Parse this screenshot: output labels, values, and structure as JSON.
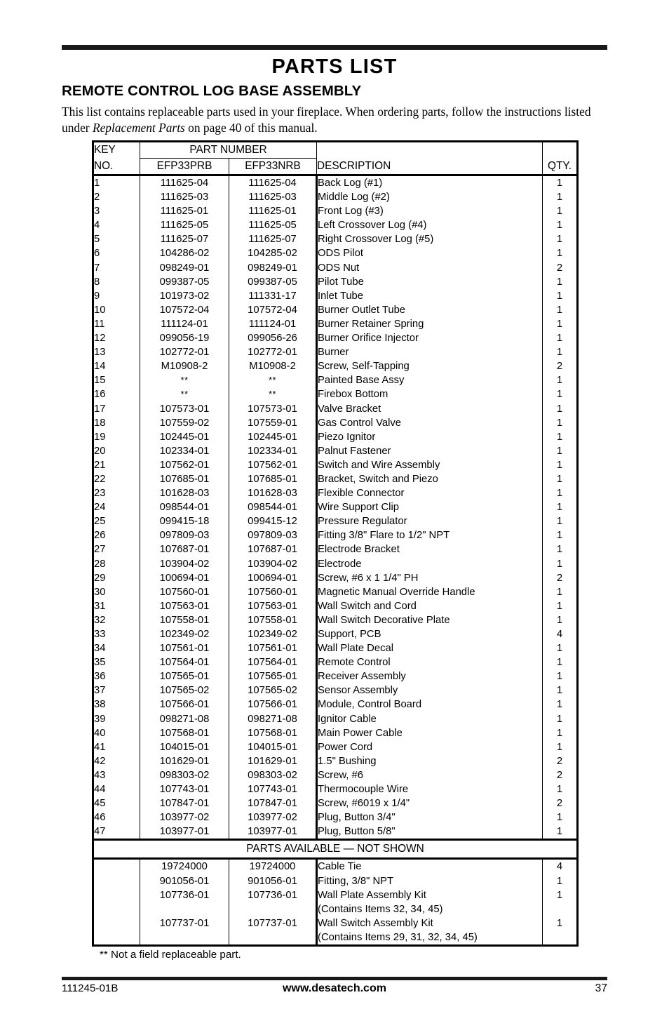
{
  "document": {
    "page_title": "PARTS LIST",
    "section_title": "REMOTE CONTROL LOG BASE ASSEMBLY",
    "intro_part1": "This list contains replaceable parts used in your fireplace. When ordering parts, follow the instructions listed under ",
    "intro_italic": "Replacement Parts",
    "intro_part2": " on page 40 of this manual.",
    "footnote": "** Not a field replaceable part.",
    "rule_color": "#1a1a1a"
  },
  "table": {
    "headers": {
      "key_line1": "KEY",
      "key_line2": "NO.",
      "part_number_group": "PART NUMBER",
      "model_1": "EFP33PRB",
      "model_2": "EFP33NRB",
      "description": "DESCRIPTION",
      "qty": "QTY."
    },
    "banner": "PARTS AVAILABLE — NOT SHOWN",
    "rows": [
      {
        "key": "1",
        "p1": "111625-04",
        "p2": "111625-04",
        "desc": "Back Log (#1)",
        "qty": "1"
      },
      {
        "key": "2",
        "p1": "111625-03",
        "p2": "111625-03",
        "desc": "Middle Log (#2)",
        "qty": "1"
      },
      {
        "key": "3",
        "p1": "111625-01",
        "p2": "111625-01",
        "desc": "Front Log (#3)",
        "qty": "1"
      },
      {
        "key": "4",
        "p1": "111625-05",
        "p2": "111625-05",
        "desc": "Left Crossover Log (#4)",
        "qty": "1"
      },
      {
        "key": "5",
        "p1": "111625-07",
        "p2": "111625-07",
        "desc": "Right Crossover Log (#5)",
        "qty": "1"
      },
      {
        "key": "6",
        "p1": "104286-02",
        "p2": "104285-02",
        "desc": "ODS Pilot",
        "qty": "1"
      },
      {
        "key": "7",
        "p1": "098249-01",
        "p2": "098249-01",
        "desc": "ODS Nut",
        "qty": "2"
      },
      {
        "key": "8",
        "p1": "099387-05",
        "p2": "099387-05",
        "desc": "Pilot Tube",
        "qty": "1"
      },
      {
        "key": "9",
        "p1": "101973-02",
        "p2": "111331-17",
        "desc": "Inlet Tube",
        "qty": "1"
      },
      {
        "key": "10",
        "p1": "107572-04",
        "p2": "107572-04",
        "desc": "Burner Outlet Tube",
        "qty": "1"
      },
      {
        "key": "11",
        "p1": "111124-01",
        "p2": "111124-01",
        "desc": "Burner Retainer Spring",
        "qty": "1"
      },
      {
        "key": "12",
        "p1": "099056-19",
        "p2": "099056-26",
        "desc": "Burner Orifice Injector",
        "qty": "1"
      },
      {
        "key": "13",
        "p1": "102772-01",
        "p2": "102772-01",
        "desc": "Burner",
        "qty": "1"
      },
      {
        "key": "14",
        "p1": "M10908-2",
        "p2": "M10908-2",
        "desc": "Screw, Self-Tapping",
        "qty": "2"
      },
      {
        "key": "15",
        "p1": "**",
        "p2": "**",
        "desc": "Painted Base Assy",
        "qty": "1"
      },
      {
        "key": "16",
        "p1": "**",
        "p2": "**",
        "desc": "Firebox Bottom",
        "qty": "1"
      },
      {
        "key": "17",
        "p1": "107573-01",
        "p2": "107573-01",
        "desc": "Valve Bracket",
        "qty": "1"
      },
      {
        "key": "18",
        "p1": "107559-02",
        "p2": "107559-01",
        "desc": "Gas Control Valve",
        "qty": "1"
      },
      {
        "key": "19",
        "p1": "102445-01",
        "p2": "102445-01",
        "desc": "Piezo Ignitor",
        "qty": "1"
      },
      {
        "key": "20",
        "p1": "102334-01",
        "p2": "102334-01",
        "desc": "Palnut Fastener",
        "qty": "1"
      },
      {
        "key": "21",
        "p1": "107562-01",
        "p2": "107562-01",
        "desc": "Switch and Wire Assembly",
        "qty": "1"
      },
      {
        "key": "22",
        "p1": "107685-01",
        "p2": "107685-01",
        "desc": "Bracket, Switch and Piezo",
        "qty": "1"
      },
      {
        "key": "23",
        "p1": "101628-03",
        "p2": "101628-03",
        "desc": "Flexible Connector",
        "qty": "1"
      },
      {
        "key": "24",
        "p1": "098544-01",
        "p2": "098544-01",
        "desc": "Wire Support Clip",
        "qty": "1"
      },
      {
        "key": "25",
        "p1": "099415-18",
        "p2": "099415-12",
        "desc": "Pressure Regulator",
        "qty": "1"
      },
      {
        "key": "26",
        "p1": "097809-03",
        "p2": "097809-03",
        "desc": "Fitting 3/8\" Flare to 1/2\" NPT",
        "qty": "1"
      },
      {
        "key": "27",
        "p1": "107687-01",
        "p2": "107687-01",
        "desc": "Electrode Bracket",
        "qty": "1"
      },
      {
        "key": "28",
        "p1": "103904-02",
        "p2": "103904-02",
        "desc": "Electrode",
        "qty": "1"
      },
      {
        "key": "29",
        "p1": "100694-01",
        "p2": "100694-01",
        "desc": "Screw, #6 x 1 1/4\" PH",
        "qty": "2"
      },
      {
        "key": "30",
        "p1": "107560-01",
        "p2": "107560-01",
        "desc": "Magnetic Manual Override Handle",
        "qty": "1"
      },
      {
        "key": "31",
        "p1": "107563-01",
        "p2": "107563-01",
        "desc": "Wall Switch and Cord",
        "qty": "1"
      },
      {
        "key": "32",
        "p1": "107558-01",
        "p2": "107558-01",
        "desc": "Wall Switch Decorative Plate",
        "qty": "1"
      },
      {
        "key": "33",
        "p1": "102349-02",
        "p2": "102349-02",
        "desc": "Support, PCB",
        "qty": "4"
      },
      {
        "key": "34",
        "p1": "107561-01",
        "p2": "107561-01",
        "desc": "Wall Plate Decal",
        "qty": "1"
      },
      {
        "key": "35",
        "p1": "107564-01",
        "p2": "107564-01",
        "desc": "Remote Control",
        "qty": "1"
      },
      {
        "key": "36",
        "p1": "107565-01",
        "p2": "107565-01",
        "desc": "Receiver Assembly",
        "qty": "1"
      },
      {
        "key": "37",
        "p1": "107565-02",
        "p2": "107565-02",
        "desc": "Sensor Assembly",
        "qty": "1"
      },
      {
        "key": "38",
        "p1": "107566-01",
        "p2": "107566-01",
        "desc": "Module, Control Board",
        "qty": "1"
      },
      {
        "key": "39",
        "p1": "098271-08",
        "p2": "098271-08",
        "desc": "Ignitor Cable",
        "qty": "1"
      },
      {
        "key": "40",
        "p1": "107568-01",
        "p2": "107568-01",
        "desc": "Main Power Cable",
        "qty": "1"
      },
      {
        "key": "41",
        "p1": "104015-01",
        "p2": "104015-01",
        "desc": "Power Cord",
        "qty": "1"
      },
      {
        "key": "42",
        "p1": "101629-01",
        "p2": "101629-01",
        "desc": "1.5\" Bushing",
        "qty": "2"
      },
      {
        "key": "43",
        "p1": "098303-02",
        "p2": "098303-02",
        "desc": "Screw, #6",
        "qty": "2"
      },
      {
        "key": "44",
        "p1": "107743-01",
        "p2": "107743-01",
        "desc": "Thermocouple Wire",
        "qty": "1"
      },
      {
        "key": "45",
        "p1": "107847-01",
        "p2": "107847-01",
        "desc": "Screw, #6019 x 1/4\"",
        "qty": "2"
      },
      {
        "key": "46",
        "p1": "103977-02",
        "p2": "103977-02",
        "desc": "Plug, Button 3/4\"",
        "qty": "1"
      },
      {
        "key": "47",
        "p1": "103977-01",
        "p2": "103977-01",
        "desc": "Plug, Button 5/8\"",
        "qty": "1"
      }
    ],
    "not_shown_rows": [
      {
        "key": "",
        "p1": "19724000",
        "p2": "19724000",
        "desc": "Cable Tie",
        "qty": "4"
      },
      {
        "key": "",
        "p1": "901056-01",
        "p2": "901056-01",
        "desc": "Fitting, 3/8\" NPT",
        "qty": "1"
      },
      {
        "key": "",
        "p1": "107736-01",
        "p2": "107736-01",
        "desc": "Wall Plate Assembly Kit",
        "qty": "1"
      },
      {
        "key": "",
        "p1": "",
        "p2": "",
        "desc": "(Contains Items 32, 34, 45)",
        "qty": ""
      },
      {
        "key": "",
        "p1": "107737-01",
        "p2": "107737-01",
        "desc": "Wall Switch Assembly Kit",
        "qty": "1"
      },
      {
        "key": "",
        "p1": "",
        "p2": "",
        "desc": "(Contains Items 29, 31, 32, 34, 45)",
        "qty": ""
      }
    ]
  },
  "footer": {
    "doc_number": "111245-01B",
    "website": "www.desatech.com",
    "page_number": "37"
  }
}
